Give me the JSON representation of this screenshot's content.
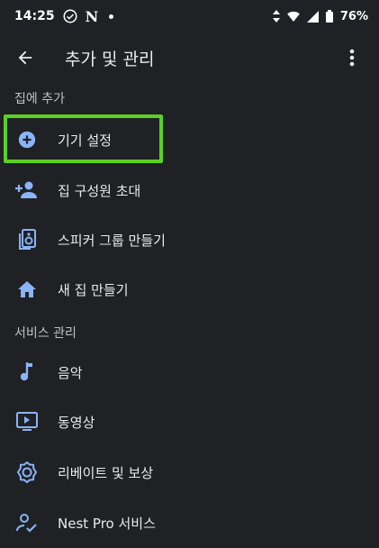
{
  "status": {
    "time": "14:25",
    "battery_pct": "76%"
  },
  "app_bar": {
    "title": "추가 및 관리",
    "back_icon": "arrow-back-icon",
    "more_icon": "more-vert-icon"
  },
  "sections": {
    "add_to_home": "집에 추가",
    "manage_services": "서비스 관리"
  },
  "items": {
    "device_setup": "기기 설정",
    "invite_member": "집 구성원 초대",
    "speaker_group": "스피커 그룹 만들기",
    "new_home": "새 집 만들기",
    "music": "음악",
    "video": "동영상",
    "rebates": "리베이트 및 보상",
    "nest_pro": "Nest Pro 서비스"
  },
  "colors": {
    "accent": "#8ab4f8",
    "highlight": "#5bd024",
    "background": "#202124"
  }
}
